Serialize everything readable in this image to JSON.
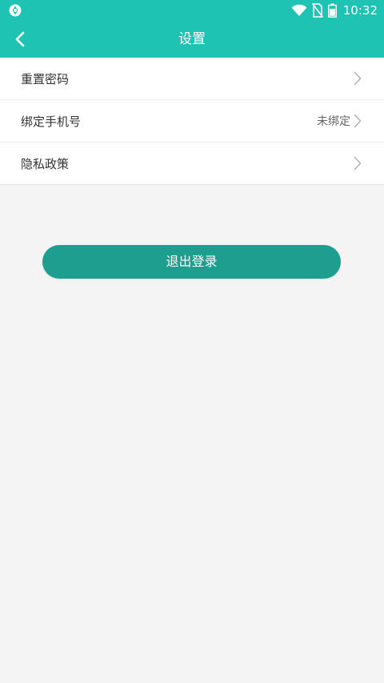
{
  "status_bar": {
    "time": "10:32",
    "icons": [
      "app-notification-icon",
      "wifi-icon",
      "no-sim-icon",
      "battery-icon"
    ]
  },
  "header": {
    "title": "设置",
    "back_icon": "chevron-left-icon"
  },
  "settings": {
    "items": [
      {
        "label": "重置密码",
        "value": ""
      },
      {
        "label": "绑定手机号",
        "value": "未绑定"
      },
      {
        "label": "隐私政策",
        "value": ""
      }
    ]
  },
  "logout": {
    "label": "退出登录"
  },
  "colors": {
    "header_bg": "#1fc3b4",
    "button_bg": "#1e9e8e",
    "page_bg": "#f4f4f4",
    "text": "#333333"
  }
}
